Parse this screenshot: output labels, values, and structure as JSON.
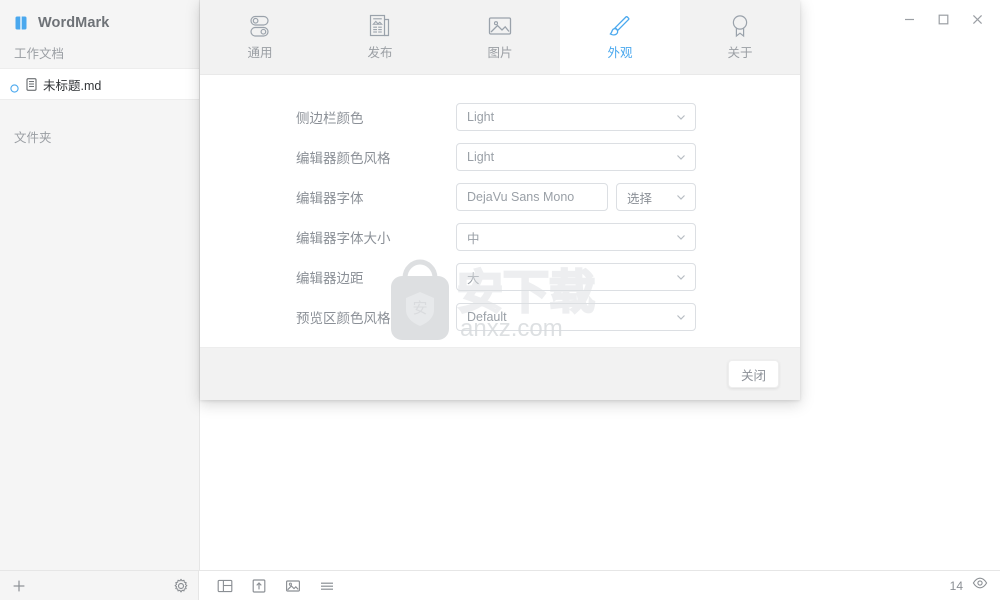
{
  "app": {
    "brand_name": "WordMark",
    "logo_icon": "book-logo-icon",
    "accent_color": "#4aa8ee"
  },
  "sidebar": {
    "work_docs_label": "工作文档",
    "folders_label": "文件夹",
    "files": [
      {
        "name": "未标题.md",
        "status_icon": "circle-unsaved-icon",
        "doc_icon": "document-icon",
        "selected": true
      }
    ]
  },
  "window_controls": {
    "minimize": "minimize-icon",
    "maximize": "maximize-icon",
    "close": "close-icon"
  },
  "dialog": {
    "tabs": [
      {
        "label": "通用",
        "icon": "toggles-icon",
        "active": false
      },
      {
        "label": "发布",
        "icon": "publish-document-icon",
        "active": false
      },
      {
        "label": "图片",
        "icon": "image-icon",
        "active": false
      },
      {
        "label": "外观",
        "icon": "paintbrush-icon",
        "active": true
      },
      {
        "label": "关于",
        "icon": "award-badge-icon",
        "active": false
      }
    ],
    "rows": [
      {
        "label": "侧边栏颜色",
        "type": "select",
        "value": "Light"
      },
      {
        "label": "编辑器颜色风格",
        "type": "select",
        "value": "Light"
      },
      {
        "label": "编辑器字体",
        "type": "text-plus-select",
        "value": "DejaVu Sans Mono",
        "button_label": "选择"
      },
      {
        "label": "编辑器字体大小",
        "type": "select",
        "value": "中"
      },
      {
        "label": "编辑器边距",
        "type": "select",
        "value": "大"
      },
      {
        "label": "预览区颜色风格",
        "type": "select",
        "value": "Default"
      }
    ],
    "footer": {
      "close_label": "关闭"
    }
  },
  "bottombar": {
    "add_label": "+",
    "icons": [
      {
        "name": "gear-icon"
      },
      {
        "name": "layout-panel-icon"
      },
      {
        "name": "export-icon"
      },
      {
        "name": "insert-image-icon"
      },
      {
        "name": "menu-icon"
      }
    ],
    "word_count": "14",
    "preview_icon": "eye-icon"
  },
  "watermark": {
    "text_cn": "安下载",
    "text_url": "anxz.com",
    "badge_char": "安"
  }
}
